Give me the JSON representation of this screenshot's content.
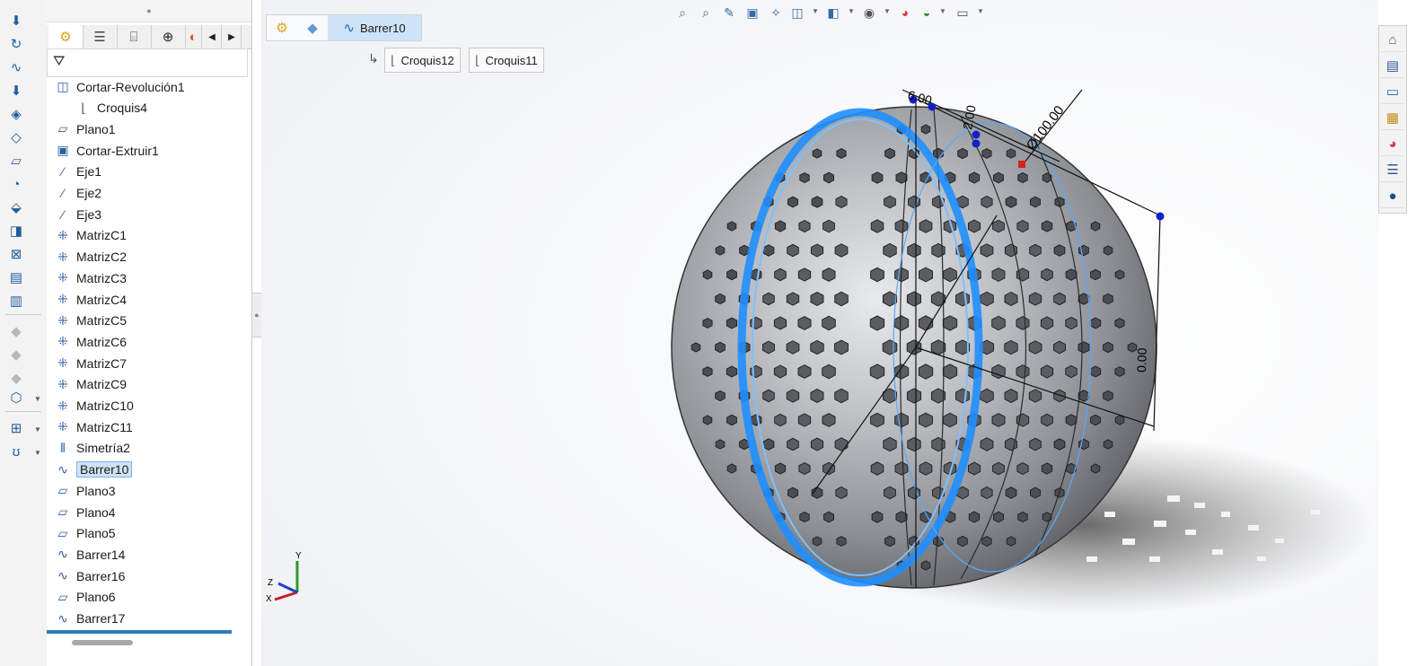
{
  "command_toolbar": {
    "icons": [
      "extrude-boss-icon",
      "revolve-boss-icon",
      "sweep-boss-icon",
      "extrude-cut-icon",
      "revolve-cut-icon",
      "sweep-cut-icon",
      "plane-icon",
      "fillet-icon",
      "chamfer-icon",
      "shell-icon",
      "draft-icon",
      "rib-icon",
      "wrap-icon",
      "pattern-icon",
      "mirror-icon",
      "disabled-icon-1",
      "disabled-icon-2",
      "disabled-icon-3",
      "reference-geometry-icon",
      "curves-icon"
    ]
  },
  "feature_manager": {
    "tabs": [
      "feature-tree-tab",
      "property-manager-tab",
      "configuration-manager-tab",
      "dimxpert-tab",
      "display-manager-tab"
    ],
    "tree_items": [
      {
        "label": "Cortar-Revolución1",
        "icon": "revolve-cut-icon",
        "sub": false,
        "selected": false
      },
      {
        "label": "Croquis4",
        "icon": "sketch-icon",
        "sub": true,
        "selected": false
      },
      {
        "label": "Plano1",
        "icon": "plane-icon",
        "sub": false,
        "selected": false
      },
      {
        "label": "Cortar-Extruir1",
        "icon": "extrude-cut-icon",
        "sub": false,
        "selected": false
      },
      {
        "label": "Eje1",
        "icon": "axis-icon",
        "sub": false,
        "selected": false
      },
      {
        "label": "Eje2",
        "icon": "axis-icon",
        "sub": false,
        "selected": false
      },
      {
        "label": "Eje3",
        "icon": "axis-icon",
        "sub": false,
        "selected": false
      },
      {
        "label": "MatrizC1",
        "icon": "pattern-icon",
        "sub": false,
        "selected": false
      },
      {
        "label": "MatrizC2",
        "icon": "pattern-icon",
        "sub": false,
        "selected": false
      },
      {
        "label": "MatrizC3",
        "icon": "pattern-icon",
        "sub": false,
        "selected": false
      },
      {
        "label": "MatrizC4",
        "icon": "pattern-icon",
        "sub": false,
        "selected": false
      },
      {
        "label": "MatrizC5",
        "icon": "pattern-icon",
        "sub": false,
        "selected": false
      },
      {
        "label": "MatrizC6",
        "icon": "pattern-icon",
        "sub": false,
        "selected": false
      },
      {
        "label": "MatrizC7",
        "icon": "pattern-icon",
        "sub": false,
        "selected": false
      },
      {
        "label": "MatrizC9",
        "icon": "pattern-icon",
        "sub": false,
        "selected": false
      },
      {
        "label": "MatrizC10",
        "icon": "pattern-icon",
        "sub": false,
        "selected": false
      },
      {
        "label": "MatrizC11",
        "icon": "pattern-icon",
        "sub": false,
        "selected": false
      },
      {
        "label": "Simetría2",
        "icon": "mirror-icon",
        "sub": false,
        "selected": false
      },
      {
        "label": "Barrer10",
        "icon": "sweep-icon",
        "sub": false,
        "selected": true
      },
      {
        "label": "Plano3",
        "icon": "plane-icon",
        "sub": false,
        "selected": false
      },
      {
        "label": "Plano4",
        "icon": "plane-icon",
        "sub": false,
        "selected": false
      },
      {
        "label": "Plano5",
        "icon": "plane-icon",
        "sub": false,
        "selected": false
      },
      {
        "label": "Barrer14",
        "icon": "sweep-icon",
        "sub": false,
        "selected": false
      },
      {
        "label": "Barrer16",
        "icon": "sweep-icon",
        "sub": false,
        "selected": false
      },
      {
        "label": "Plano6",
        "icon": "plane-icon",
        "sub": false,
        "selected": false
      },
      {
        "label": "Barrer17",
        "icon": "sweep-icon",
        "sub": false,
        "selected": false
      }
    ]
  },
  "breadcrumb": {
    "current": "Barrer10",
    "sub_items": [
      "Croquis12",
      "Croquis11"
    ]
  },
  "heads_up_toolbar": {
    "icons": [
      "zoom-to-fit-icon",
      "zoom-to-area-icon",
      "previous-view-icon",
      "section-view-icon",
      "dynamic-annotation-icon",
      "view-orientation-icon",
      "display-style-icon",
      "hide-show-icon",
      "edit-appearance-icon",
      "apply-scene-icon",
      "view-settings-icon"
    ]
  },
  "task_pane": {
    "icons": [
      "home-icon",
      "design-library-icon",
      "file-explorer-icon",
      "view-palette-icon",
      "appearances-icon",
      "custom-properties-icon",
      "solidworks-forum-icon"
    ]
  },
  "model": {
    "dimensions": [
      "6.00",
      "2.00",
      "Ø100.00",
      "0.00"
    ],
    "accent_color": "#1f8fff",
    "body_color": "#a6a9ae"
  },
  "triad": {
    "labels": [
      "Y",
      "Z",
      "X"
    ]
  }
}
